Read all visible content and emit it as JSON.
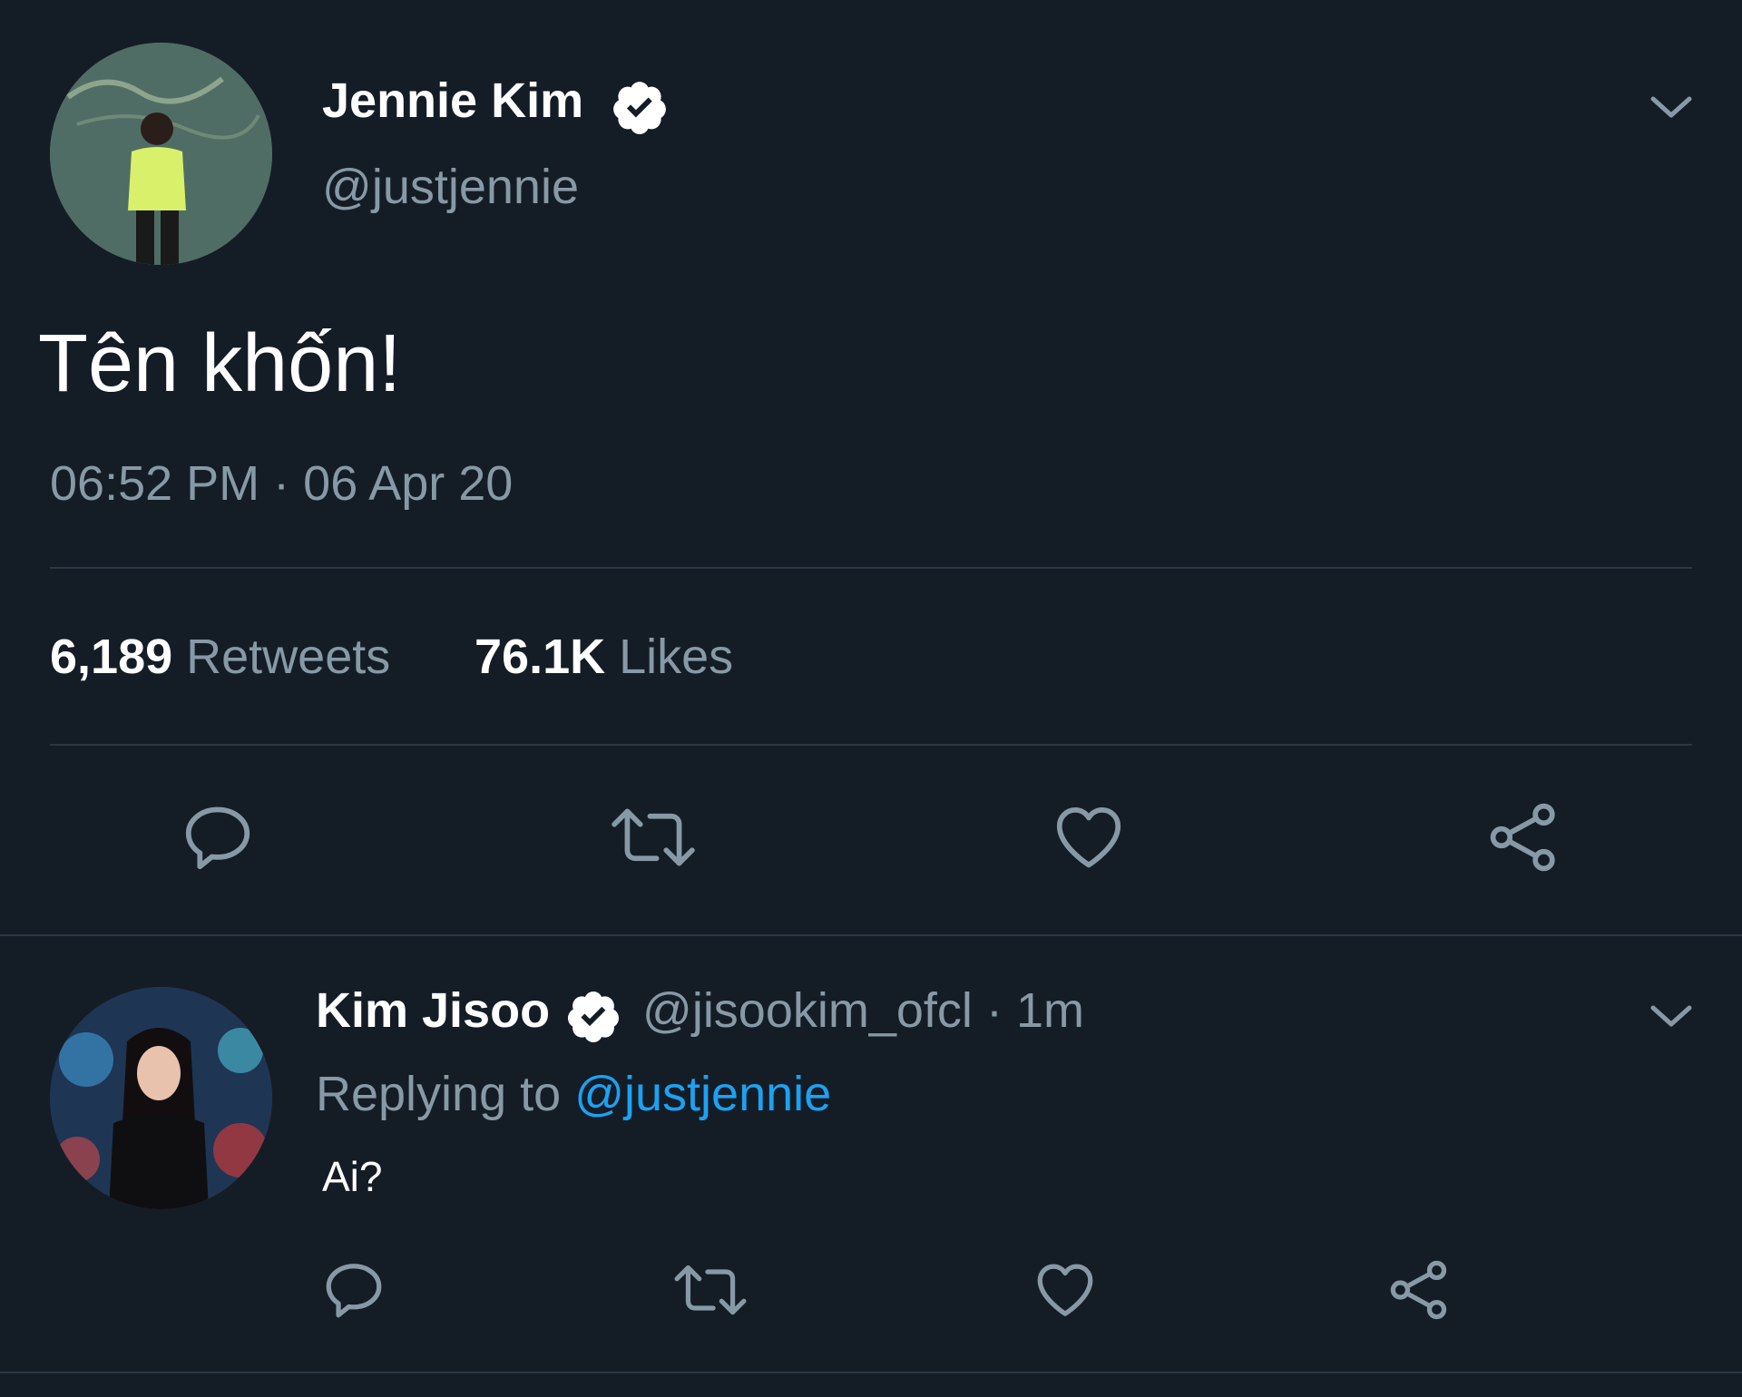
{
  "main_tweet": {
    "author_name": "Jennie Kim",
    "author_handle": "@justjennie",
    "text": "Tên khốn!",
    "time": "06:52 PM",
    "date": "06 Apr 20",
    "separator": "·",
    "retweets_count": "6,189",
    "retweets_label": "Retweets",
    "likes_count": "76.1K",
    "likes_label": "Likes"
  },
  "reply_tweet": {
    "author_name": "Kim Jisoo",
    "author_handle": "@jisookim_ofcl",
    "separator": "·",
    "age": "1m",
    "replying_prefix": "Replying to",
    "replying_handle": "@justjennie",
    "text": "Ai?"
  },
  "icons": {
    "verified": "verified-badge-icon",
    "menu": "chevron-down-icon",
    "reply": "reply-icon",
    "retweet": "retweet-icon",
    "like": "heart-icon",
    "share": "share-icon"
  },
  "colors": {
    "background": "#141d26",
    "secondary_text": "#8899a6",
    "link": "#1da1f2",
    "divider": "#2a3744"
  }
}
